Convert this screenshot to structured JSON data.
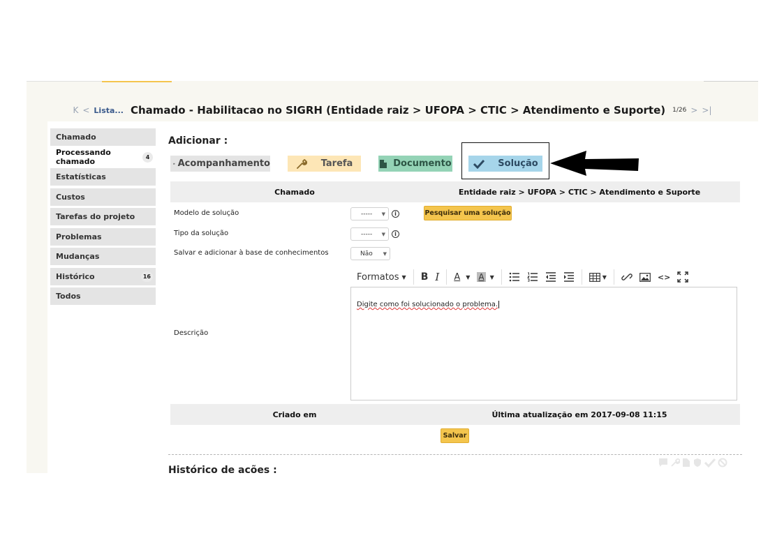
{
  "header": {
    "first_glyph": "K",
    "prev_glyph": "<",
    "list_link": "Lista...",
    "title": "Chamado - Habilitacao no SIGRH (Entidade raiz > UFOPA > CTIC > Atendimento e Suporte)",
    "counter": "1/26",
    "next_glyph": ">",
    "last_glyph": ">|"
  },
  "sidebar": {
    "items": [
      {
        "label": "Chamado",
        "badge": ""
      },
      {
        "label": "Processando chamado",
        "badge": "4"
      },
      {
        "label": "Estatísticas",
        "badge": ""
      },
      {
        "label": "Custos",
        "badge": ""
      },
      {
        "label": "Tarefas do projeto",
        "badge": ""
      },
      {
        "label": "Problemas",
        "badge": ""
      },
      {
        "label": "Mudanças",
        "badge": ""
      },
      {
        "label": "Histórico",
        "badge": "16"
      },
      {
        "label": "Todos",
        "badge": ""
      }
    ]
  },
  "main": {
    "add_title": "Adicionar :",
    "tabs": {
      "acompanhamento": "Acompanhamento",
      "tarefa": "Tarefa",
      "documento": "Documento",
      "solucao": "Solução"
    },
    "table_header": {
      "left": "Chamado",
      "right": "Entidade raiz > UFOPA > CTIC > Atendimento e Suporte"
    },
    "fields": {
      "modelo_label": "Modelo de solução",
      "modelo_value": "-----",
      "pesquisar_button": "Pesquisar uma solução",
      "tipo_label": "Tipo da solução",
      "tipo_value": "-----",
      "salvar_base_label": "Salvar e adicionar à base de conhecimentos",
      "salvar_base_value": "Não",
      "descricao_label": "Descrição",
      "info_glyph": "i"
    },
    "editor": {
      "formats_label": "Formatos",
      "bold": "B",
      "italic": "I",
      "font_color": "A",
      "bg_color": "A",
      "code": "<>",
      "content": "Digite como foi solucionado o problema."
    },
    "footer_header": {
      "left": "Criado em",
      "right": "Última atualização em 2017-09-08 11:15"
    },
    "save_button": "Salvar",
    "history_title": "Histórico de ações :"
  },
  "colors": {
    "accent_yellow": "#f4c54d",
    "tab_tarefa": "#fde6b6",
    "tab_documento": "#94d3b6",
    "tab_solucao": "#a6d5ea",
    "tab_acompanhamento": "#e4e4e4",
    "header_strip": "#f8f7f1"
  }
}
